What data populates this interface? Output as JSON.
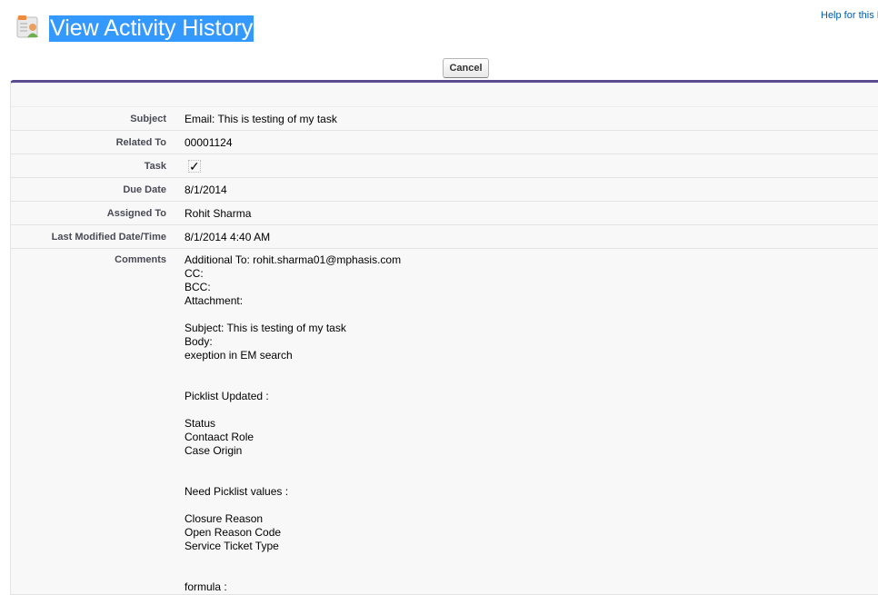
{
  "header": {
    "title": "View Activity History",
    "help_link": "Help for this Page",
    "icon": "activity-history-icon"
  },
  "toolbar": {
    "cancel_label": "Cancel"
  },
  "fields": {
    "subject": {
      "label": "Subject",
      "value": "Email: This is testing of my task"
    },
    "related_to": {
      "label": "Related To",
      "value": "00001124"
    },
    "task": {
      "label": "Task",
      "value": "✓",
      "checked": true
    },
    "due_date": {
      "label": "Due Date",
      "value": "8/1/2014"
    },
    "assigned_to": {
      "label": "Assigned To",
      "value": "Rohit Sharma"
    },
    "last_modified": {
      "label": "Last Modified Date/Time",
      "value": "8/1/2014 4:40 AM"
    },
    "comments": {
      "label": "Comments",
      "value": "Additional To: rohit.sharma01@mphasis.com\nCC:\nBCC:\nAttachment:\n \nSubject: This is testing of my task\nBody:\nexeption in EM search\n \n \nPicklist Updated :\n \nStatus\nContaact Role\nCase Origin\n \n \nNeed Picklist values :\n \nClosure Reason\nOpen Reason Code\nService Ticket Type\n \n \nformula :"
    }
  }
}
